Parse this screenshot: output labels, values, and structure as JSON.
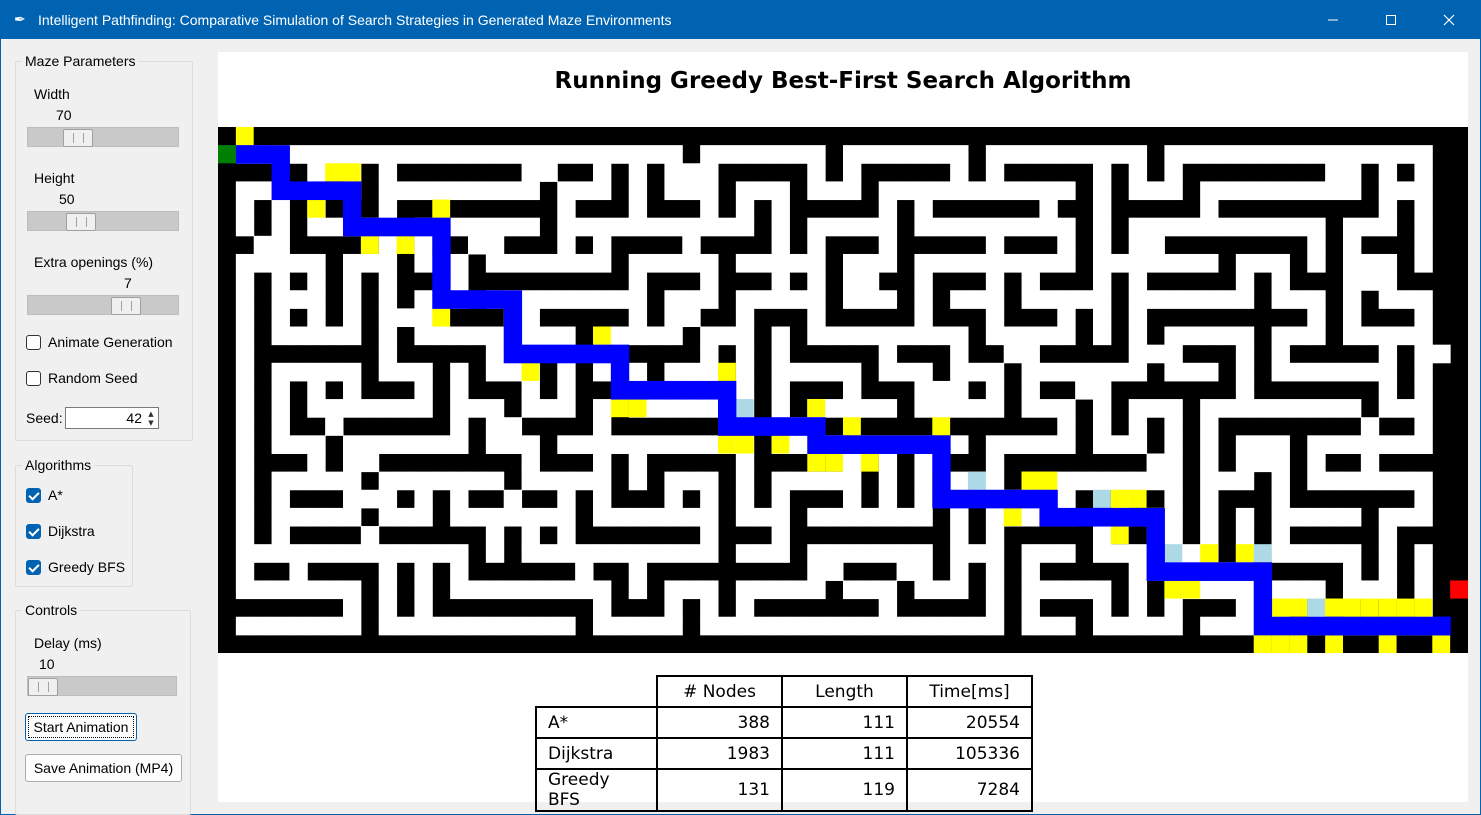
{
  "window": {
    "title": "Intelligent Pathfinding: Comparative Simulation of Search Strategies in Generated Maze Environments"
  },
  "maze_params": {
    "legend": "Maze Parameters",
    "width_label": "Width",
    "width_value": "70",
    "width_fraction": 0.3,
    "height_label": "Height",
    "height_value": "50",
    "height_fraction": 0.32,
    "extra_label": "Extra openings (%)",
    "extra_value": "7",
    "extra_fraction": 0.7,
    "animate_label": "Animate Generation",
    "animate_checked": false,
    "random_label": "Random Seed",
    "random_checked": false,
    "seed_label": "Seed:",
    "seed_value": "42"
  },
  "algorithms": {
    "legend": "Algorithms",
    "items": [
      {
        "label": "A*",
        "checked": true
      },
      {
        "label": "Dijkstra",
        "checked": true
      },
      {
        "label": "Greedy BFS",
        "checked": true
      }
    ]
  },
  "controls": {
    "legend": "Controls",
    "delay_label": "Delay (ms)",
    "delay_value": "10",
    "delay_fraction": 0.0,
    "start_button": "Start Animation",
    "save_button": "Save Animation (MP4)"
  },
  "plot": {
    "title": "Running Greedy Best-First Search Algorithm"
  },
  "colors": {
    "path": "#0000ff",
    "frontier": "#ffff00",
    "visited": "#add8e6",
    "start": "#008000",
    "goal": "#ff0000",
    "wall": "#000000",
    "titlebar": "#0063b1"
  },
  "stats_table": {
    "columns": [
      "# Nodes",
      "Length",
      "Time[ms]"
    ],
    "rows": [
      {
        "name": "A*",
        "nodes": "388",
        "length": "111",
        "time": "20554"
      },
      {
        "name": "Dijkstra",
        "nodes": "1983",
        "length": "111",
        "time": "105336"
      },
      {
        "name": "Greedy BFS",
        "nodes": "131",
        "length": "119",
        "time": "7284"
      }
    ]
  }
}
